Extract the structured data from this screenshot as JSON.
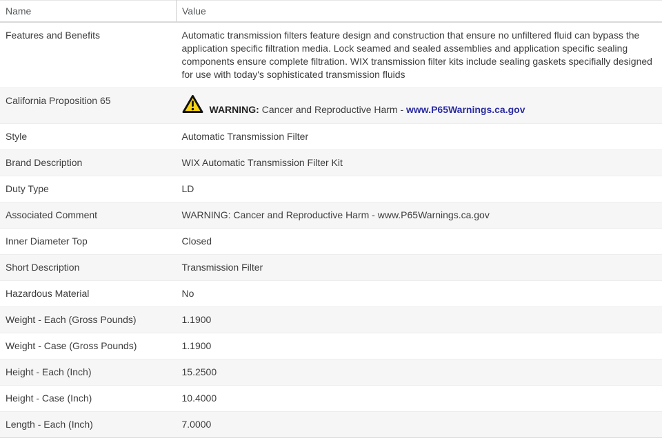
{
  "header": {
    "name_label": "Name",
    "value_label": "Value"
  },
  "rows": [
    {
      "name": "Features and Benefits",
      "value": "Automatic transmission filters feature design and construction that ensure no unfiltered fluid can bypass the application specific filtration media. Lock seamed and sealed assemblies and application specific sealing components ensure complete filtration. WIX transmission filter kits include sealing gaskets specifially designed for use with today's sophisticated transmission fluids"
    },
    {
      "name": "California Proposition 65",
      "warning": {
        "icon": "warning-triangle-icon",
        "label": "WARNING:",
        "text": " Cancer and Reproductive Harm - ",
        "link": "www.P65Warnings.ca.gov"
      }
    },
    {
      "name": "Style",
      "value": "Automatic Transmission Filter"
    },
    {
      "name": "Brand Description",
      "value": "WIX Automatic Transmission Filter Kit"
    },
    {
      "name": "Duty Type",
      "value": "LD"
    },
    {
      "name": "Associated Comment",
      "value": "WARNING: Cancer and Reproductive Harm - www.P65Warnings.ca.gov"
    },
    {
      "name": "Inner Diameter Top",
      "value": "Closed"
    },
    {
      "name": "Short Description",
      "value": "Transmission Filter"
    },
    {
      "name": "Hazardous Material",
      "value": "No"
    },
    {
      "name": "Weight - Each (Gross Pounds)",
      "value": "1.1900"
    },
    {
      "name": "Weight - Case (Gross Pounds)",
      "value": "1.1900"
    },
    {
      "name": "Height - Each (Inch)",
      "value": "15.2500"
    },
    {
      "name": "Height - Case (Inch)",
      "value": "10.4000"
    },
    {
      "name": "Length - Each (Inch)",
      "value": "7.0000"
    }
  ],
  "colors": {
    "link_blue": "#2a2ba0",
    "warning_yellow": "#f8d410",
    "warning_border": "#111111",
    "row_alt_bg": "#f6f6f6"
  }
}
